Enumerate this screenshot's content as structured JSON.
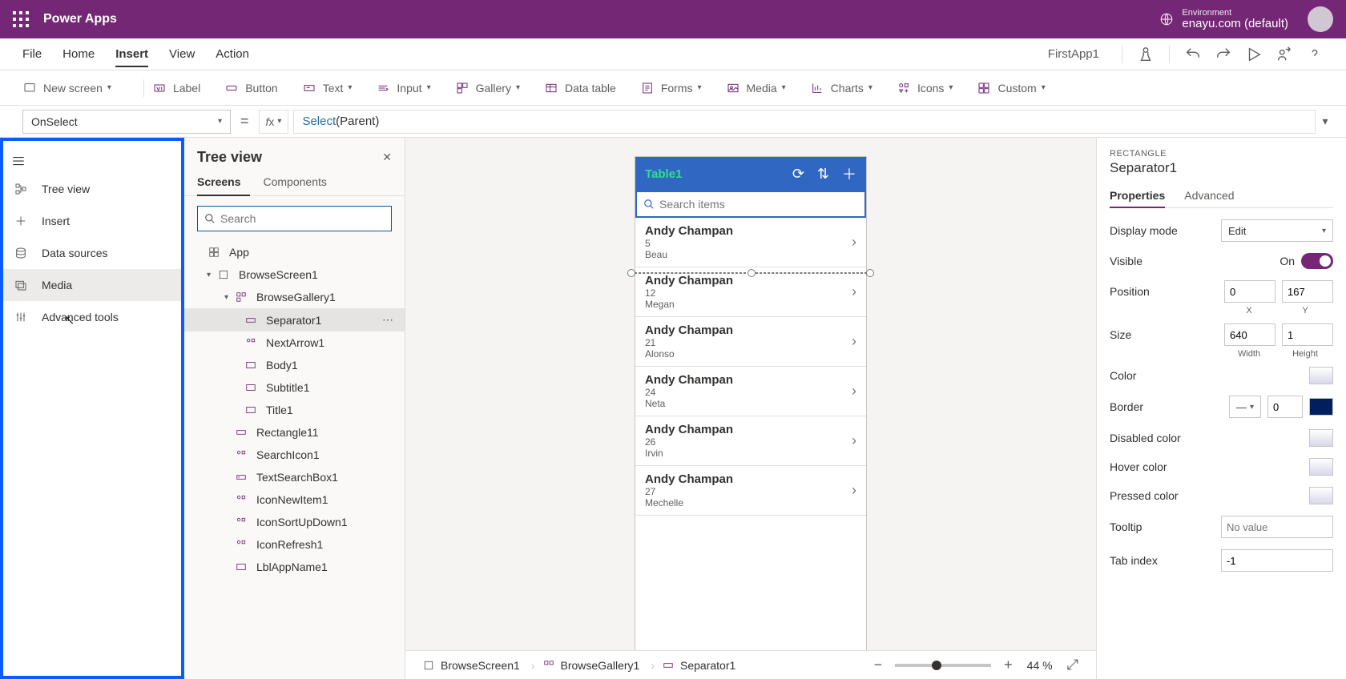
{
  "topbar": {
    "title": "Power Apps",
    "env_label": "Environment",
    "env_name": "enayu.com (default)"
  },
  "menubar": {
    "items": [
      "File",
      "Home",
      "Insert",
      "View",
      "Action"
    ],
    "active": "Insert",
    "app_name": "FirstApp1"
  },
  "ribbon": {
    "new_screen": "New screen",
    "label": "Label",
    "button": "Button",
    "text": "Text",
    "input": "Input",
    "gallery": "Gallery",
    "data_table": "Data table",
    "forms": "Forms",
    "media": "Media",
    "charts": "Charts",
    "icons": "Icons",
    "custom": "Custom"
  },
  "formula": {
    "property": "OnSelect",
    "fn": "Select",
    "arg": "(Parent)"
  },
  "leftrail": {
    "items": [
      "Tree view",
      "Insert",
      "Data sources",
      "Media",
      "Advanced tools"
    ]
  },
  "tree": {
    "title": "Tree view",
    "tabs": [
      "Screens",
      "Components"
    ],
    "search_placeholder": "Search",
    "nodes": {
      "app": "App",
      "browsescreen": "BrowseScreen1",
      "browsegallery": "BrowseGallery1",
      "separator": "Separator1",
      "nextarrow": "NextArrow1",
      "body": "Body1",
      "subtitle": "Subtitle1",
      "title": "Title1",
      "rectangle": "Rectangle11",
      "searchicon": "SearchIcon1",
      "textsearch": "TextSearchBox1",
      "iconnew": "IconNewItem1",
      "iconsort": "IconSortUpDown1",
      "iconrefresh": "IconRefresh1",
      "lblapp": "LblAppName1"
    }
  },
  "phone": {
    "title": "Table1",
    "search_placeholder": "Search items",
    "items": [
      {
        "title": "Andy Champan",
        "sub": "5",
        "body": "Beau"
      },
      {
        "title": "Andy Champan",
        "sub": "12",
        "body": "Megan"
      },
      {
        "title": "Andy Champan",
        "sub": "21",
        "body": "Alonso"
      },
      {
        "title": "Andy Champan",
        "sub": "24",
        "body": "Neta"
      },
      {
        "title": "Andy Champan",
        "sub": "26",
        "body": "Irvin"
      },
      {
        "title": "Andy Champan",
        "sub": "27",
        "body": "Mechelle"
      }
    ]
  },
  "breadcrumb": {
    "items": [
      "BrowseScreen1",
      "BrowseGallery1",
      "Separator1"
    ],
    "zoom": "44",
    "zoom_unit": "%"
  },
  "props": {
    "type": "RECTANGLE",
    "name": "Separator1",
    "tabs": [
      "Properties",
      "Advanced"
    ],
    "display_mode_label": "Display mode",
    "display_mode": "Edit",
    "visible_label": "Visible",
    "visible_value": "On",
    "position_label": "Position",
    "position_x": "0",
    "position_y": "167",
    "x_label": "X",
    "y_label": "Y",
    "size_label": "Size",
    "size_w": "640",
    "size_h": "1",
    "w_label": "Width",
    "h_label": "Height",
    "color_label": "Color",
    "border_label": "Border",
    "border_value": "0",
    "disabled_label": "Disabled color",
    "hover_label": "Hover color",
    "pressed_label": "Pressed color",
    "tooltip_label": "Tooltip",
    "tooltip_placeholder": "No value",
    "tabindex_label": "Tab index",
    "tabindex": "-1"
  }
}
